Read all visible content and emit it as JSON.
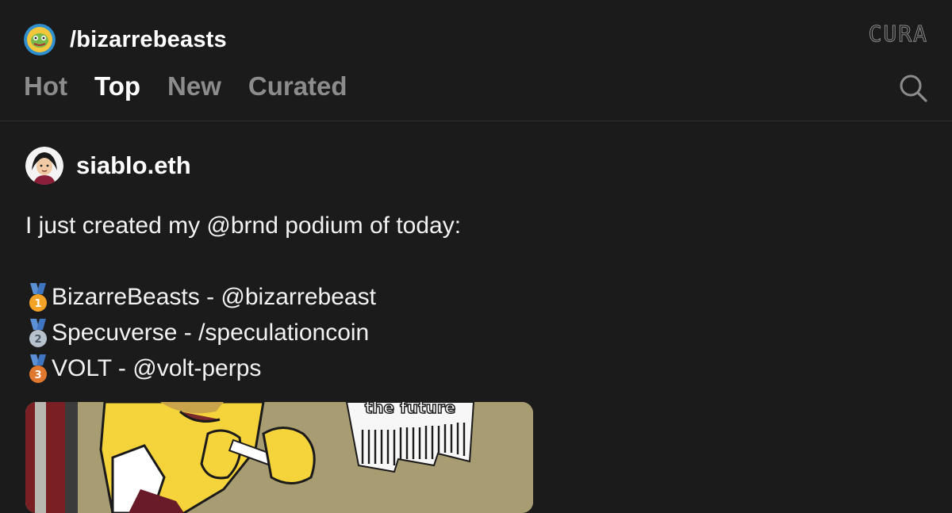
{
  "channel": {
    "name": "/bizarrebeasts"
  },
  "brand": {
    "text": "CURA"
  },
  "tabs": [
    {
      "label": "Hot",
      "active": false
    },
    {
      "label": "Top",
      "active": true
    },
    {
      "label": "New",
      "active": false
    },
    {
      "label": "Curated",
      "active": false
    }
  ],
  "search": {
    "icon": "search-icon"
  },
  "post": {
    "author": "siablo.eth",
    "intro": "I just created my @brnd podium of today:",
    "podium": [
      {
        "rank": "1",
        "medal": "gold-medal-icon",
        "text": "BizarreBeasts - @bizarrebeast"
      },
      {
        "rank": "2",
        "medal": "silver-medal-icon",
        "text": "Specuverse - /speculationcoin"
      },
      {
        "rank": "3",
        "medal": "bronze-medal-icon",
        "text": "VOLT - @volt-perps"
      }
    ],
    "image_caption": "the future"
  },
  "colors": {
    "background": "#1b1b1b",
    "active_tab": "#ffffff",
    "inactive_tab": "#8c8c8c",
    "gold": "#f4a326",
    "silver": "#b8c2cc",
    "bronze": "#e0782f",
    "ribbon": "#5b8fd6"
  }
}
